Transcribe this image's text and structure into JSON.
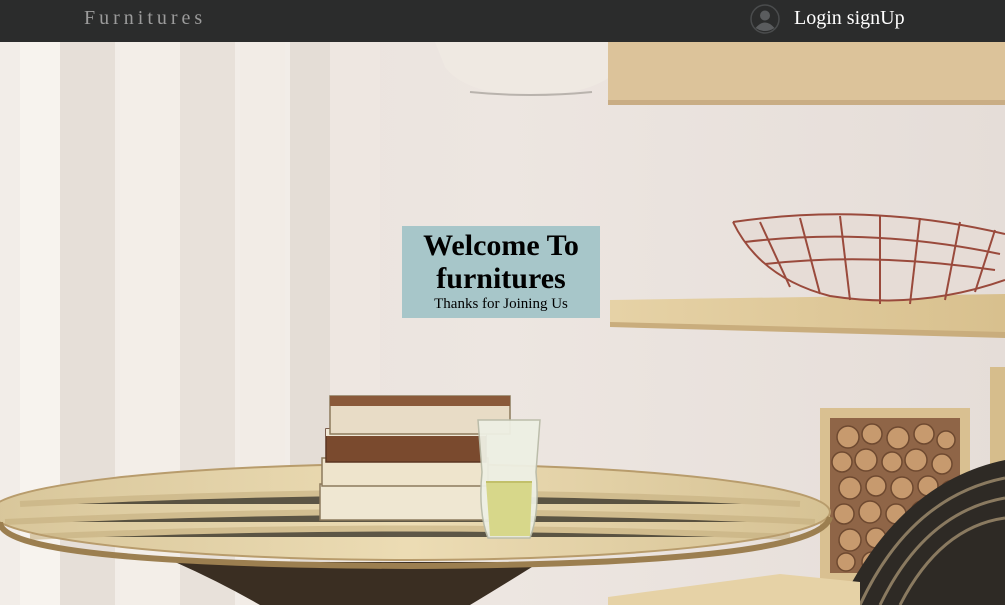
{
  "navbar": {
    "brand": "Furnitures",
    "user_icon": "user-circle-icon",
    "login_label": "Login",
    "signup_label": "signUp"
  },
  "hero": {
    "welcome_line1": "Welcome To",
    "welcome_line2": "furnitures",
    "tagline": "Thanks for Joining Us",
    "welcome_bg": "#a7c6c9"
  },
  "colors": {
    "navbar_bg": "#2b2c2c",
    "brand_text": "#9b9b9b",
    "nav_text": "#ffffff"
  }
}
